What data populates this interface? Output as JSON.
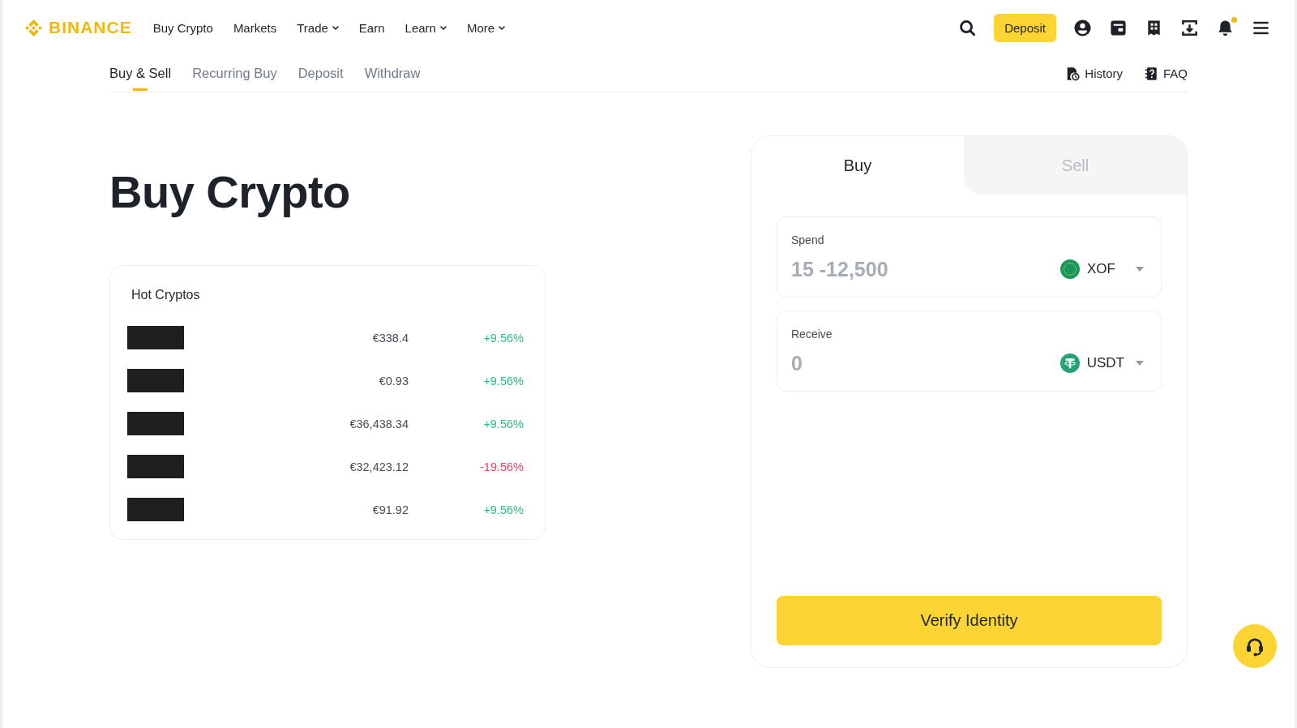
{
  "header": {
    "brand": "BINANCE",
    "nav": [
      {
        "label": "Buy Crypto",
        "dropdown": false
      },
      {
        "label": "Markets",
        "dropdown": false
      },
      {
        "label": "Trade",
        "dropdown": true
      },
      {
        "label": "Earn",
        "dropdown": false
      },
      {
        "label": "Learn",
        "dropdown": true
      },
      {
        "label": "More",
        "dropdown": true
      }
    ],
    "deposit_button": "Deposit",
    "notifications_unread": true
  },
  "subnav": {
    "tabs": [
      {
        "label": "Buy & Sell",
        "selected": true
      },
      {
        "label": "Recurring Buy",
        "selected": false
      },
      {
        "label": "Deposit",
        "selected": false
      },
      {
        "label": "Withdraw",
        "selected": false
      }
    ],
    "links": [
      {
        "label": "History",
        "kind": "history"
      },
      {
        "label": "FAQ",
        "kind": "faq"
      }
    ]
  },
  "page_title": "Buy Crypto",
  "hot_cryptos": {
    "title": "Hot Cryptos",
    "rows": [
      {
        "price": "€338.4",
        "change": "+9.56%",
        "color": "#2ebd85"
      },
      {
        "price": "€0.93",
        "change": "+9.56%",
        "color": "#2ebd85"
      },
      {
        "price": "€36,438.34",
        "change": "+9.56%",
        "color": "#2ebd85"
      },
      {
        "price": "€32,423.12",
        "change": "-19.56%",
        "color": "#f6465d"
      },
      {
        "price": "€91.92",
        "change": "+9.56%",
        "color": "#2ebd85"
      }
    ]
  },
  "trade_panel": {
    "tabs": [
      {
        "label": "Buy",
        "selected": true
      },
      {
        "label": "Sell",
        "selected": false
      }
    ],
    "fields": [
      {
        "label": "Spend",
        "placeholder": "15 -12,500",
        "currency": {
          "code": "XOF",
          "kind": "fiat"
        }
      },
      {
        "label": "Receive",
        "placeholder": "0",
        "currency": {
          "code": "USDT",
          "kind": "tether"
        }
      }
    ],
    "submit_button": "Verify Identity"
  }
}
